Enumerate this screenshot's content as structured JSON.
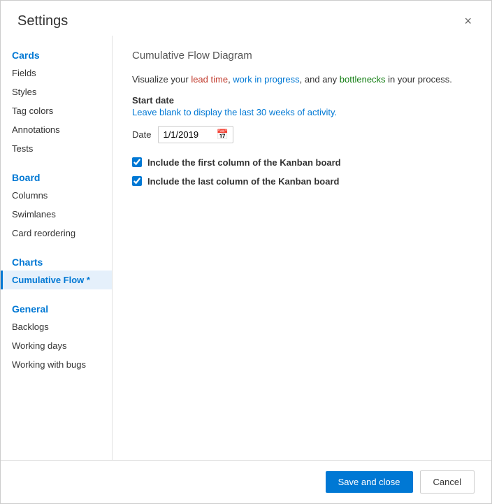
{
  "dialog": {
    "title": "Settings",
    "close_icon": "×"
  },
  "sidebar": {
    "cards_section": "Cards",
    "cards_items": [
      {
        "label": "Fields",
        "active": false
      },
      {
        "label": "Styles",
        "active": false
      },
      {
        "label": "Tag colors",
        "active": false
      },
      {
        "label": "Annotations",
        "active": false
      },
      {
        "label": "Tests",
        "active": false
      }
    ],
    "board_section": "Board",
    "board_items": [
      {
        "label": "Columns",
        "active": false
      },
      {
        "label": "Swimlanes",
        "active": false
      },
      {
        "label": "Card reordering",
        "active": false
      }
    ],
    "charts_section": "Charts",
    "charts_items": [
      {
        "label": "Cumulative Flow *",
        "active": true
      }
    ],
    "general_section": "General",
    "general_items": [
      {
        "label": "Backlogs",
        "active": false
      },
      {
        "label": "Working days",
        "active": false
      },
      {
        "label": "Working with bugs",
        "active": false
      }
    ]
  },
  "main": {
    "section_title": "Cumulative Flow Diagram",
    "description": {
      "part1": "Visualize your lead time, work in progress, and any bottlenecks in your process.",
      "red_words": "lead time",
      "blue_words": "work in progress",
      "green_words": "bottlenecks"
    },
    "start_date_label": "Start date",
    "start_date_hint": "Leave blank to display the last 30 weeks of activity.",
    "date_label": "Date",
    "date_value": "1/1/2019",
    "date_placeholder": "1/1/2019",
    "checkbox1_label": "Include the first column of the Kanban board",
    "checkbox1_checked": true,
    "checkbox2_label": "Include the last column of the Kanban board",
    "checkbox2_checked": true
  },
  "footer": {
    "save_label": "Save and close",
    "cancel_label": "Cancel"
  }
}
